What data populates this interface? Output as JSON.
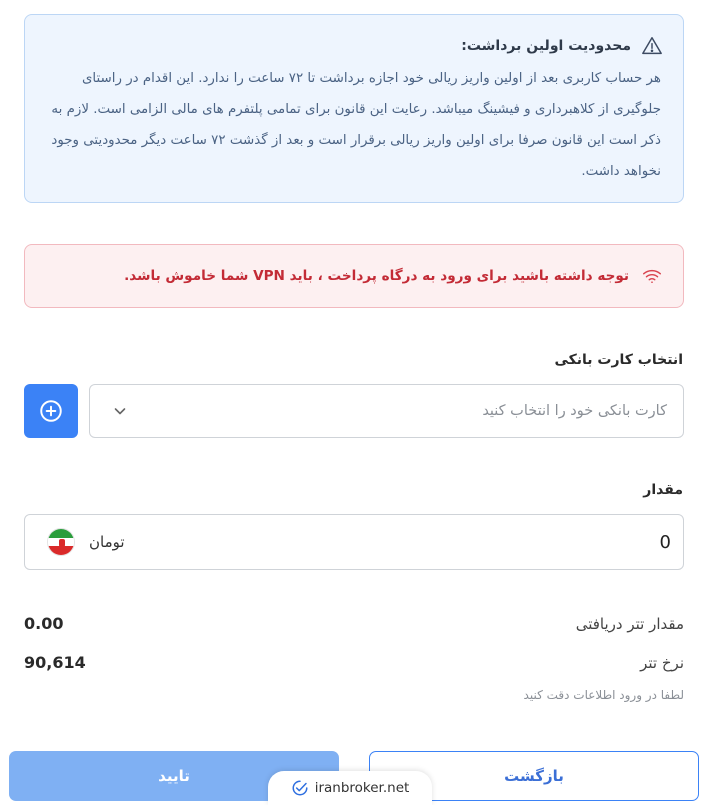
{
  "limit_notice": {
    "title": "محدودیت اولین برداشت:",
    "body": "هر حساب کاربری بعد از اولین واریز ریالی خود اجازه برداشت تا ۷۲ ساعت را ندارد. این اقدام در راستای جلوگیری از کلاهبرداری و فیشینگ میباشد. رعایت این قانون برای تمامی پلتفرم های مالی الزامی است. لازم به ذکر است این قانون صرفا برای اولین واریز ریالی برقرار است و بعد از گذشت ۷۲ ساعت دیگر محدودیتی وجود نخواهد داشت.",
    "icon": "warning-triangle-icon",
    "accent": "#bcd6f5"
  },
  "vpn_notice": {
    "text": "توجه داشته باشید برای ورود به درگاه پرداخت ، باید VPN شما خاموش باشد.",
    "icon": "wifi-icon",
    "color": "#c32b36"
  },
  "bank_card": {
    "label": "انتخاب کارت بانکی",
    "placeholder": "کارت بانکی خود را انتخاب کنید",
    "icon": "chevron-down-icon",
    "add_icon": "plus-circle-icon"
  },
  "amount": {
    "label": "مقدار",
    "value": "0",
    "currency": "تومان",
    "flag_icon": "iran-flag-icon"
  },
  "summary": {
    "received_label": "مقدار تتر دریافتی",
    "received_value": "0.00",
    "rate_label": "نرخ تتر",
    "rate_value": "90,614",
    "hint": "لطفا در ورود اطلاعات دقت کنید"
  },
  "actions": {
    "confirm": "تایید",
    "back": "بازگشت",
    "primary_color": "#3b82f6"
  },
  "watermark": {
    "text": "iranbroker.net",
    "icon": "check-badge-icon"
  }
}
